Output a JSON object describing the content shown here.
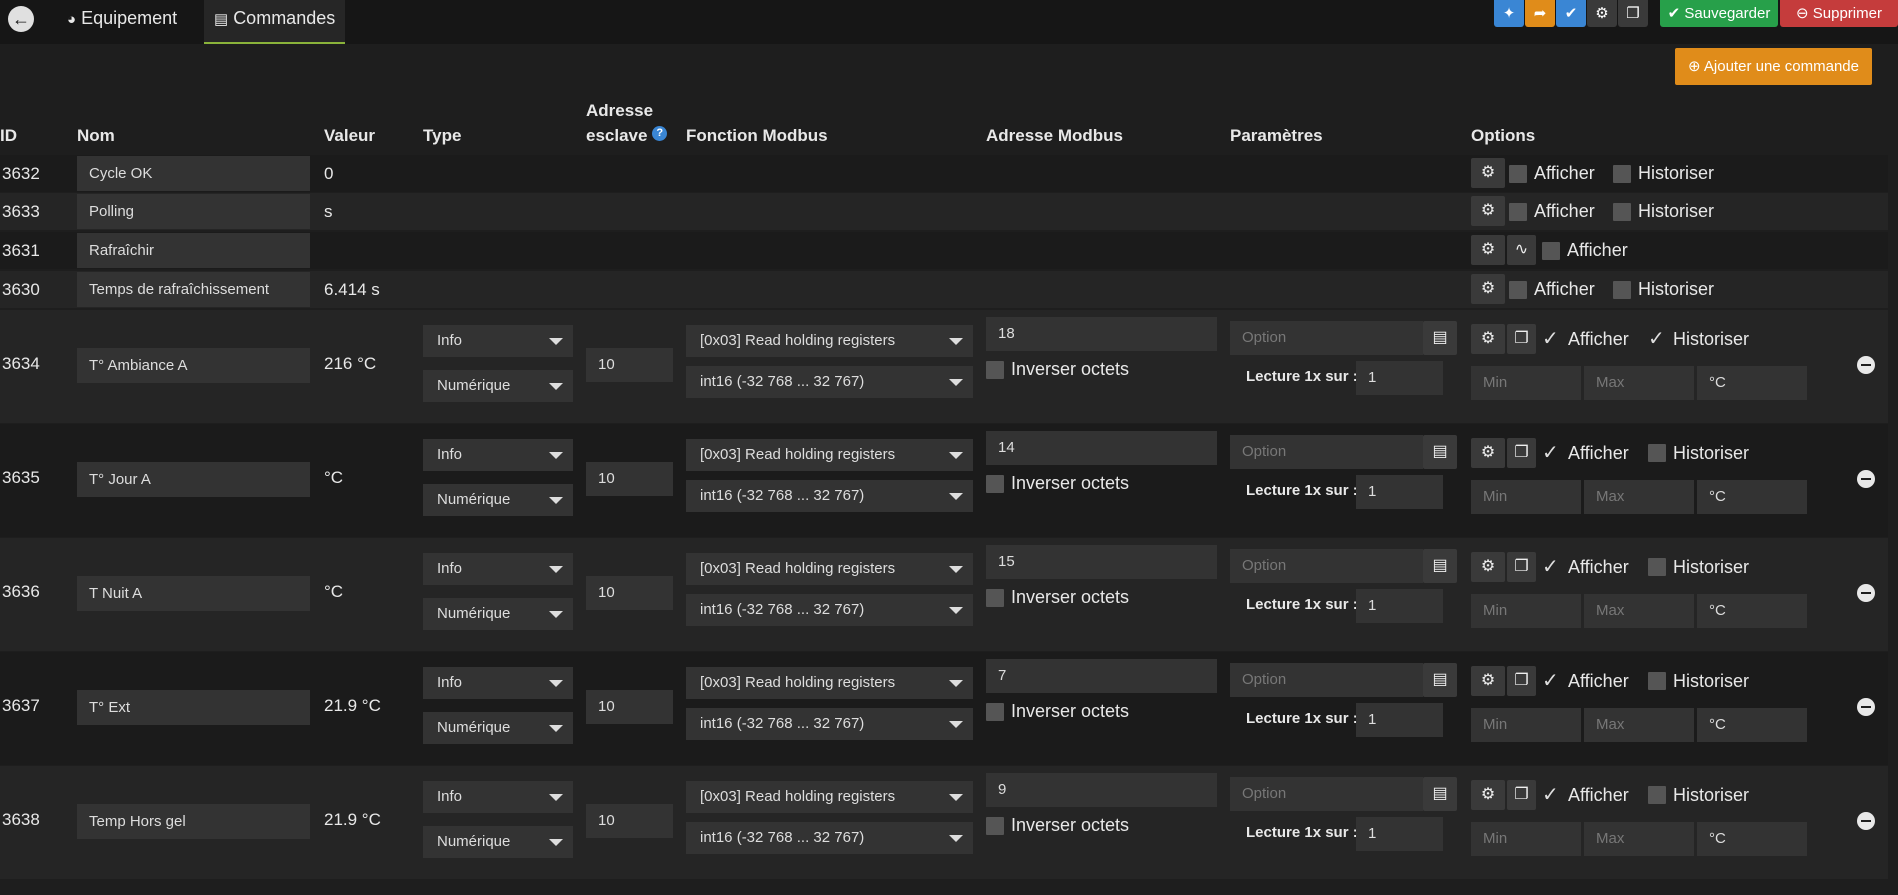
{
  "tabs": [
    {
      "label": "Equipement"
    },
    {
      "label": "Commandes"
    }
  ],
  "toolbar": {
    "save_label": "Sauvegarder",
    "delete_label": "Supprimer",
    "add_label": "Ajouter une commande"
  },
  "colors": {
    "blue": "#3a86d4",
    "orange": "#e08c1a",
    "green": "#27a04a",
    "red": "#c53c3c",
    "dark_btn": "#3a3a3a"
  },
  "headers": {
    "id": "ID",
    "name": "Nom",
    "value": "Valeur",
    "type": "Type",
    "slave1": "Adresse",
    "slave2": "esclave",
    "func": "Fonction Modbus",
    "addr": "Adresse Modbus",
    "params": "Paramètres",
    "options": "Options"
  },
  "labels": {
    "afficher": "Afficher",
    "historiser": "Historiser",
    "inverser": "Inverser octets",
    "lecture": "Lecture 1x sur :",
    "option_ph": "Option",
    "min_ph": "Min",
    "max_ph": "Max"
  },
  "simple_rows": [
    {
      "id": "3632",
      "name": "Cycle OK",
      "value": "0",
      "history": true
    },
    {
      "id": "3633",
      "name": "Polling",
      "value": "s",
      "history": true
    },
    {
      "id": "3631",
      "name": "Rafraîchir",
      "value": "",
      "history": false
    },
    {
      "id": "3630",
      "name": "Temps de rafraîchissement",
      "value": "6.414 s",
      "history": true
    }
  ],
  "rows": [
    {
      "id": "3634",
      "name": "T° Ambiance A",
      "value": "216 °C",
      "type": "Info",
      "subtype": "Numérique",
      "slave": "10",
      "func": "[0x03] Read holding registers",
      "format": "int16 (-32 768 ... 32 767)",
      "addr": "18",
      "lecture": "1",
      "unit": "°C",
      "afficher": true,
      "historiser": true
    },
    {
      "id": "3635",
      "name": "T° Jour A",
      "value": "°C",
      "type": "Info",
      "subtype": "Numérique",
      "slave": "10",
      "func": "[0x03] Read holding registers",
      "format": "int16 (-32 768 ... 32 767)",
      "addr": "14",
      "lecture": "1",
      "unit": "°C",
      "afficher": true,
      "historiser": false
    },
    {
      "id": "3636",
      "name": "T Nuit A",
      "value": "°C",
      "type": "Info",
      "subtype": "Numérique",
      "slave": "10",
      "func": "[0x03] Read holding registers",
      "format": "int16 (-32 768 ... 32 767)",
      "addr": "15",
      "lecture": "1",
      "unit": "°C",
      "afficher": true,
      "historiser": false
    },
    {
      "id": "3637",
      "name": "T° Ext",
      "value": "21.9 °C",
      "type": "Info",
      "subtype": "Numérique",
      "slave": "10",
      "func": "[0x03] Read holding registers",
      "format": "int16 (-32 768 ... 32 767)",
      "addr": "7",
      "lecture": "1",
      "unit": "°C",
      "afficher": true,
      "historiser": false
    },
    {
      "id": "3638",
      "name": "Temp Hors gel",
      "value": "21.9 °C",
      "type": "Info",
      "subtype": "Numérique",
      "slave": "10",
      "func": "[0x03] Read holding registers",
      "format": "int16 (-32 768 ... 32 767)",
      "addr": "9",
      "lecture": "1",
      "unit": "°C",
      "afficher": true,
      "historiser": false
    }
  ]
}
